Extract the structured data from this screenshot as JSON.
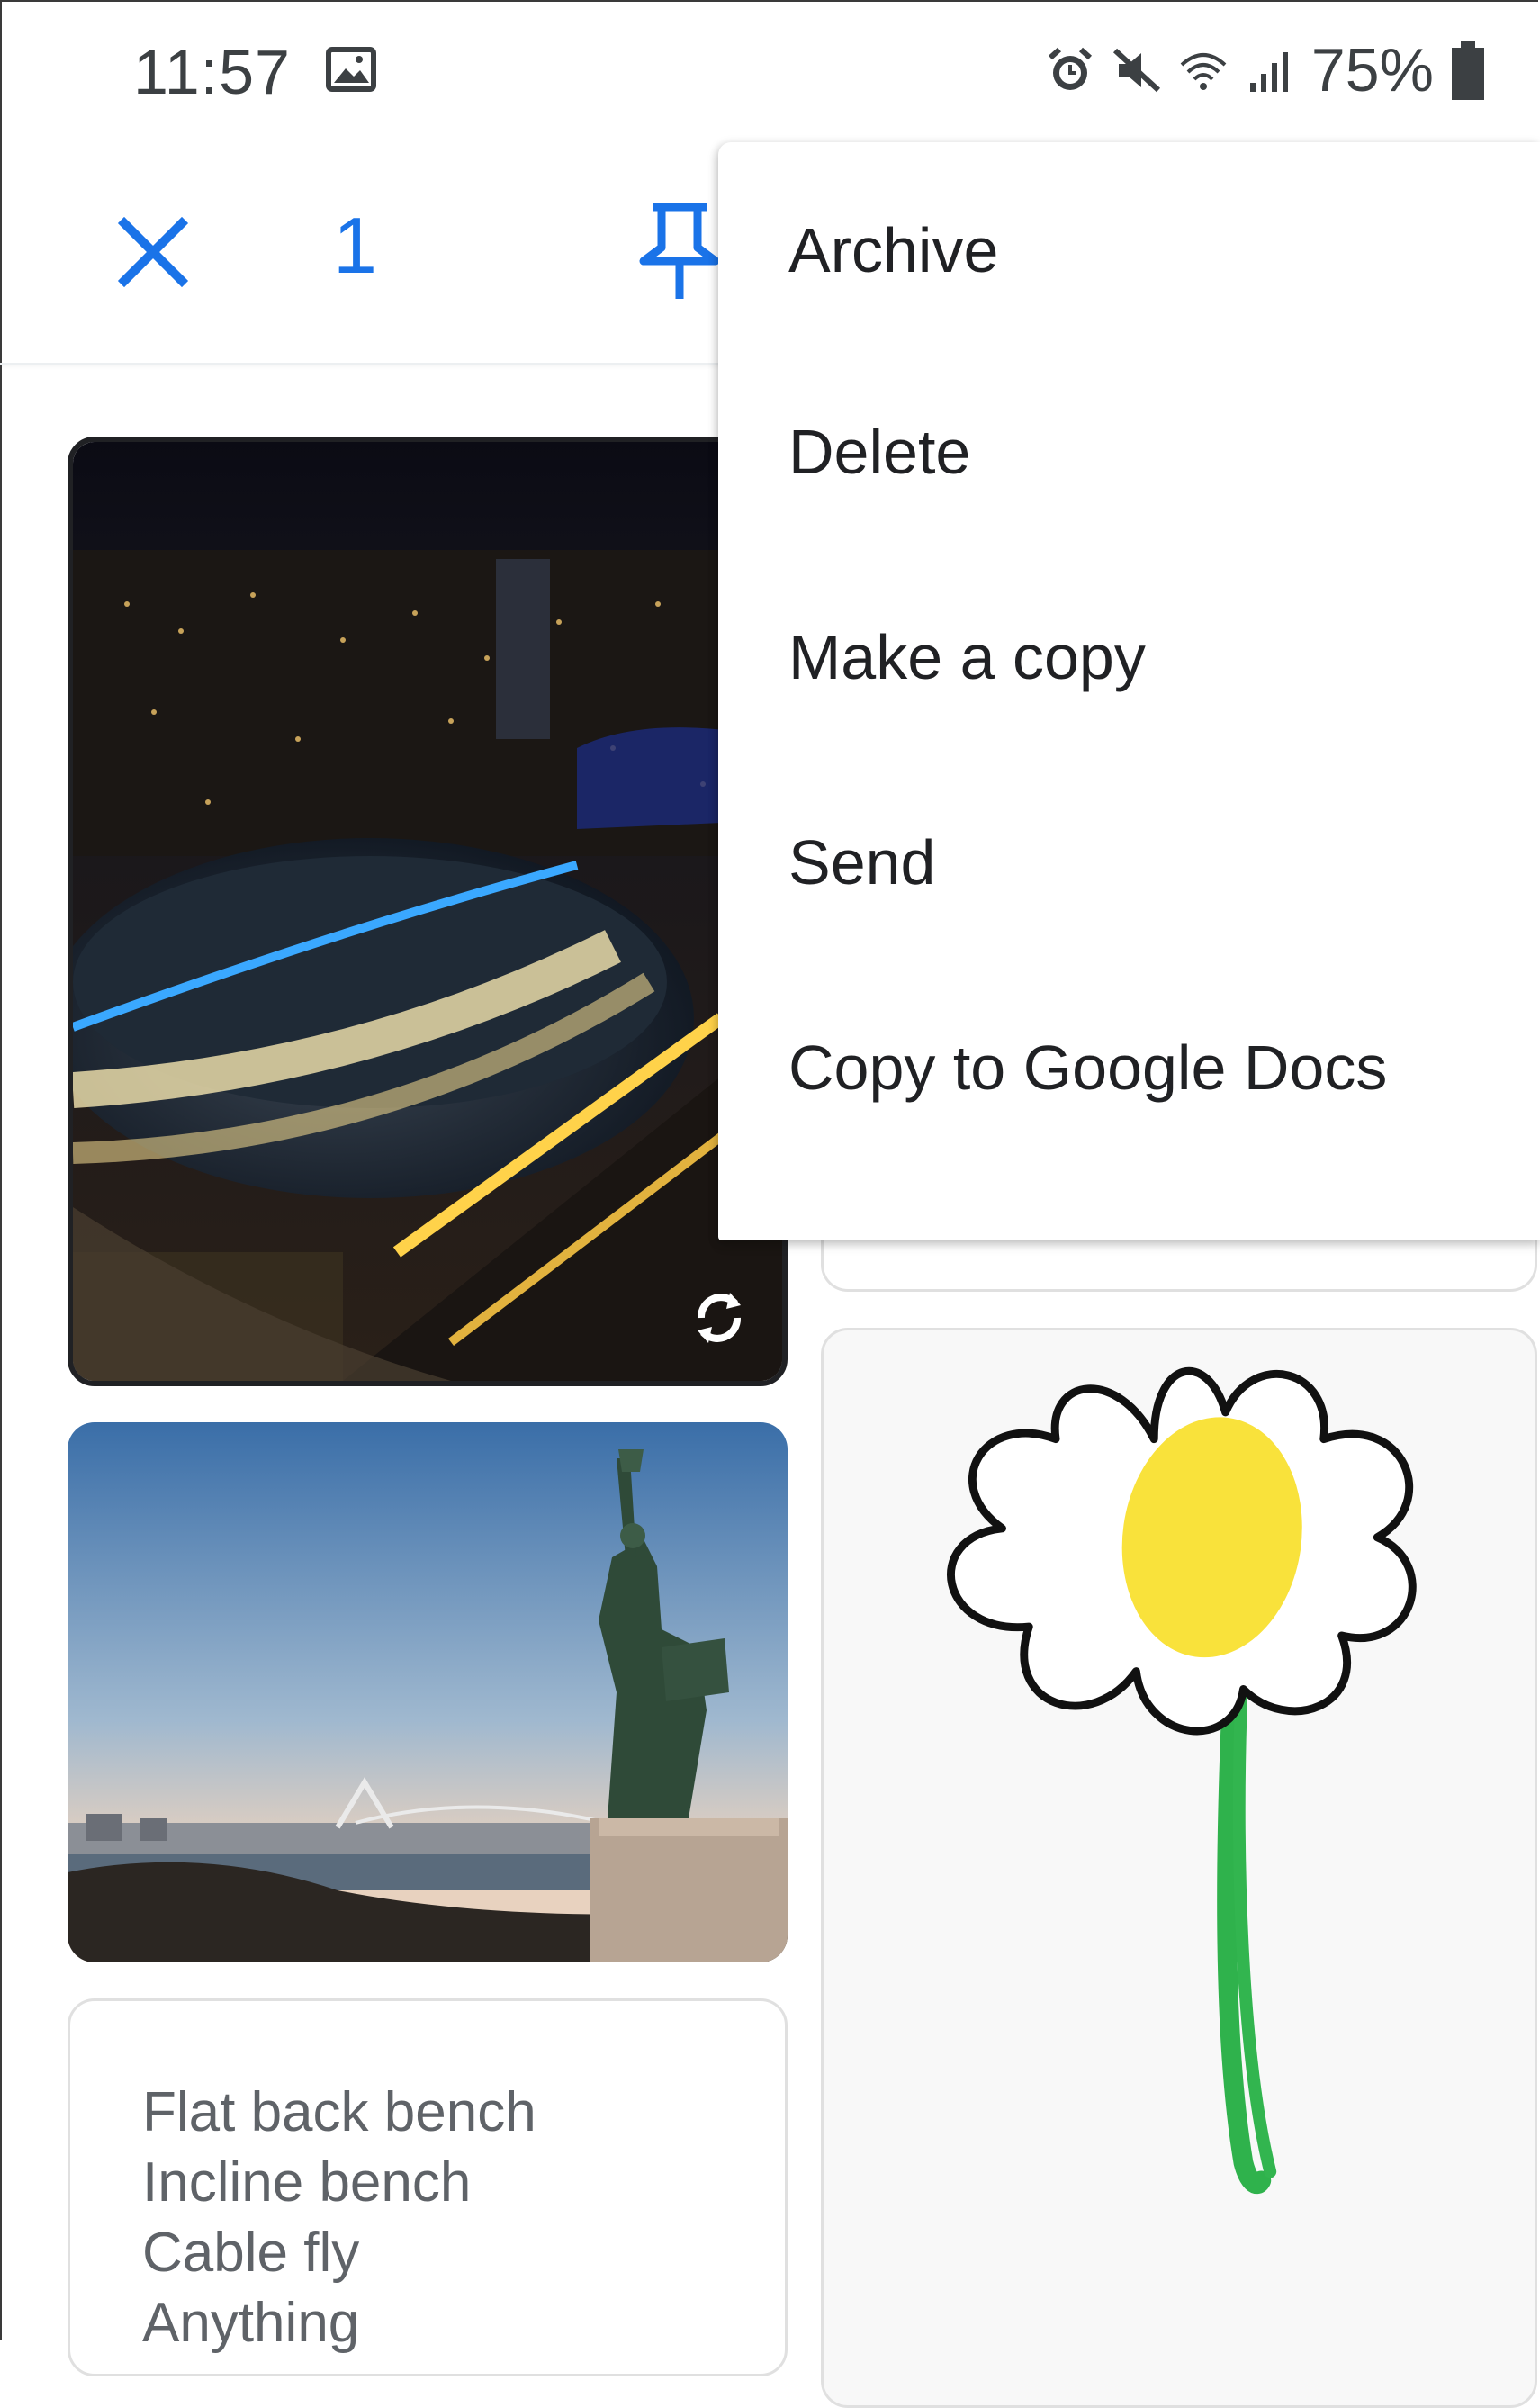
{
  "status_bar": {
    "time": "11:57",
    "battery": "75%",
    "icons": [
      "gallery-icon",
      "alarm-icon",
      "mute-icon",
      "wifi-icon",
      "signal-icon",
      "battery-icon"
    ]
  },
  "action_bar": {
    "selected_count": "1",
    "icons": [
      "close-icon",
      "pin-icon"
    ],
    "accent_color": "#1a73e8"
  },
  "menu": {
    "items": [
      {
        "label": "Archive"
      },
      {
        "label": "Delete"
      },
      {
        "label": "Make a copy"
      },
      {
        "label": "Send"
      },
      {
        "label": "Copy to Google Docs"
      }
    ]
  },
  "notes": {
    "photo_note_1": {
      "description_icon": "rotate-icon"
    },
    "list_note": {
      "lines": [
        "Flat back bench",
        "Incline bench",
        "Cable fly",
        "Anything"
      ]
    }
  }
}
